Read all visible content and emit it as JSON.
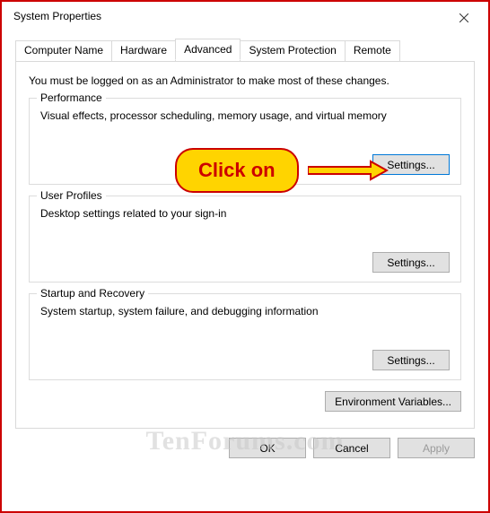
{
  "window": {
    "title": "System Properties"
  },
  "tabs": {
    "computer_name": "Computer Name",
    "hardware": "Hardware",
    "advanced": "Advanced",
    "system_protection": "System Protection",
    "remote": "Remote"
  },
  "info_line": "You must be logged on as an Administrator to make most of these changes.",
  "performance": {
    "title": "Performance",
    "desc": "Visual effects, processor scheduling, memory usage, and virtual memory",
    "settings_label": "Settings..."
  },
  "user_profiles": {
    "title": "User Profiles",
    "desc": "Desktop settings related to your sign-in",
    "settings_label": "Settings..."
  },
  "startup_recovery": {
    "title": "Startup and Recovery",
    "desc": "System startup, system failure, and debugging information",
    "settings_label": "Settings..."
  },
  "env_vars_label": "Environment Variables...",
  "dialog_buttons": {
    "ok": "OK",
    "cancel": "Cancel",
    "apply": "Apply"
  },
  "callout": {
    "text": "Click on"
  },
  "watermark": "TenForums.com"
}
